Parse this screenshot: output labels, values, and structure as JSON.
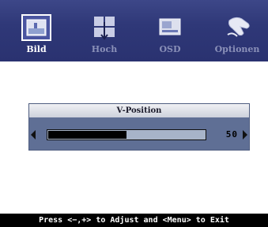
{
  "tabs": [
    {
      "label": "Bild",
      "icon": "picture-icon",
      "active": true
    },
    {
      "label": "Hoch",
      "icon": "position-icon",
      "active": false
    },
    {
      "label": "OSD",
      "icon": "osd-icon",
      "active": false
    },
    {
      "label": "Optionen",
      "icon": "options-hand-icon",
      "active": false
    }
  ],
  "panel": {
    "title": "V-Position",
    "value": "50",
    "level_percent": 50
  },
  "footer": {
    "hint": "Press <−,+> to Adjust and <Menu> to Exit"
  },
  "colors": {
    "topbar": "#2f3878",
    "panel": "#5f6f95",
    "track": "#a7b4c9",
    "fill": "#000000"
  }
}
